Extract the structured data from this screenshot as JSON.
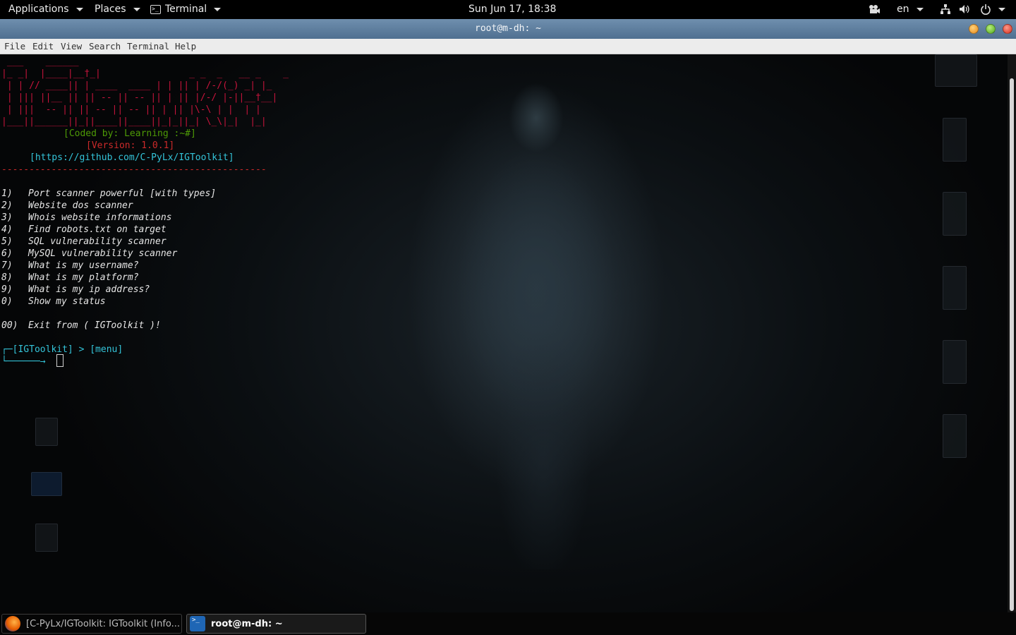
{
  "top_panel": {
    "applications": "Applications",
    "places": "Places",
    "terminal": "Terminal",
    "clock": "Sun Jun 17, 18:38",
    "language": "en"
  },
  "window": {
    "title": "root@m-dh: ~"
  },
  "menubar": [
    "File",
    "Edit",
    "View",
    "Search",
    "Terminal",
    "Help"
  ],
  "terminal": {
    "ascii_art": [
      " ___    ______",
      "|_ _|  |____|__†_|                _ _  _   __ _    _",
      " | | // ____|| | ____  ____ | | || | /-/(_) _| |_",
      " | ||| ||__ || || -- || -- || | || |/-/ |-||__†__|",
      " | |||  -- || || -- || -- || | || |\\-\\ | |  | |",
      "|___||______||_||____||____||_|_||_| \\_\\|_|  |_|"
    ],
    "coded_by": "[Coded by: Learning :~#]",
    "version": "[Version: 1.0.1]",
    "url": "[https://github.com/C-PyLx/IGToolkit]",
    "divider": "------------------------------------------------",
    "menu": [
      {
        "num": "1)",
        "text": "Port scanner powerful [with types]"
      },
      {
        "num": "2)",
        "text": "Website dos scanner"
      },
      {
        "num": "3)",
        "text": "Whois website informations"
      },
      {
        "num": "4)",
        "text": "Find robots.txt on target"
      },
      {
        "num": "5)",
        "text": "SQL vulnerability scanner"
      },
      {
        "num": "6)",
        "text": "MySQL vulnerability scanner"
      },
      {
        "num": "7)",
        "text": "What is my username?"
      },
      {
        "num": "8)",
        "text": "What is my platform?"
      },
      {
        "num": "9)",
        "text": "What is my ip address?"
      },
      {
        "num": "0)",
        "text": "Show my status"
      }
    ],
    "exit_option": {
      "num": "00)",
      "text": "Exit from ( IGToolkit )!"
    },
    "prompt_line1": "┌─[IGToolkit] > [menu]",
    "prompt_line2": "└──────→"
  },
  "taskbar": {
    "browser_task": "[C-PyLx/IGToolkit: IGToolkit (Info...",
    "terminal_task": "root@m-dh: ~"
  },
  "colors": {
    "ascii_red": "#c8143c",
    "coded_green": "#4e9a06",
    "version_red": "#cc2a2a",
    "url_cyan": "#34c4d9",
    "prompt_cyan": "#34c4d9",
    "divider_red": "#cc2a2a"
  }
}
